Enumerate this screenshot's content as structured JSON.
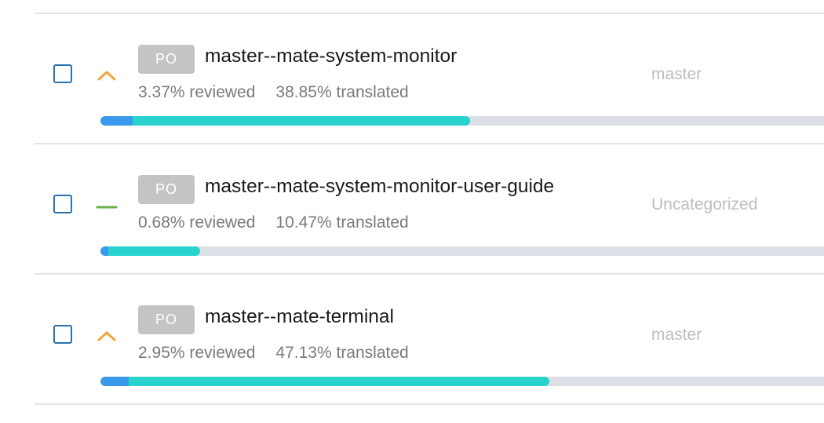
{
  "colors": {
    "reviewed": "#3a99ea",
    "translated": "#27d3cc",
    "track": "#dcdfe6",
    "priority_high": "#f0a53a",
    "priority_normal": "#6ab04c",
    "checkbox_border": "#2a6fb0"
  },
  "documents": [
    {
      "badge": "PO",
      "name": "master--mate-system-monitor",
      "reviewed_text": "3.37% reviewed",
      "translated_text": "38.85% translated",
      "category": "master",
      "priority_icon": "chevron-up-icon",
      "priority": "high",
      "reviewed_fraction": 0.0337,
      "translated_fraction": 0.3885
    },
    {
      "badge": "PO",
      "name": "master--mate-system-monitor-user-guide",
      "reviewed_text": "0.68% reviewed",
      "translated_text": "10.47% translated",
      "category": "Uncategorized",
      "priority_icon": "dash-icon",
      "priority": "normal",
      "reviewed_fraction": 0.0068,
      "translated_fraction": 0.1047
    },
    {
      "badge": "PO",
      "name": "master--mate-terminal",
      "reviewed_text": "2.95% reviewed",
      "translated_text": "47.13% translated",
      "category": "master",
      "priority_icon": "chevron-up-icon",
      "priority": "high",
      "reviewed_fraction": 0.0295,
      "translated_fraction": 0.4713
    }
  ]
}
